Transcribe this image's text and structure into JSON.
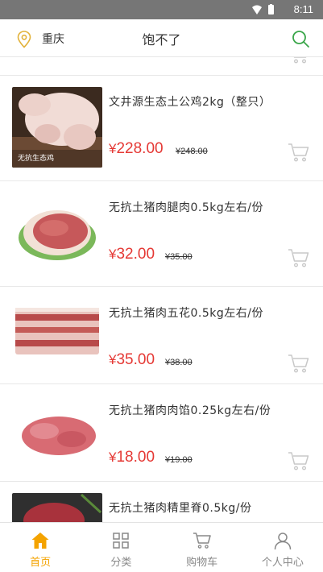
{
  "status": {
    "time": "8:11"
  },
  "header": {
    "city": "重庆",
    "title": "饱不了"
  },
  "products": [
    {
      "name": "",
      "price": "",
      "original": ""
    },
    {
      "name": "文井源生态土公鸡2kg（整只）",
      "price": "228.00",
      "original": "¥248.00",
      "image_overlay": "无抗生态鸡"
    },
    {
      "name": "无抗土猪肉腿肉0.5kg左右/份",
      "price": "32.00",
      "original": "¥35.00"
    },
    {
      "name": "无抗土猪肉五花0.5kg左右/份",
      "price": "35.00",
      "original": "¥38.00"
    },
    {
      "name": "无抗土猪肉肉馅0.25kg左右/份",
      "price": "18.00",
      "original": "¥19.00"
    },
    {
      "name": "无抗土猪肉精里脊0.5kg/份",
      "price": "",
      "original": ""
    }
  ],
  "currency_symbol": "¥",
  "tabbar": [
    {
      "label": "首页",
      "icon": "home-icon",
      "active": true
    },
    {
      "label": "分类",
      "icon": "category-icon",
      "active": false
    },
    {
      "label": "购物车",
      "icon": "cart-icon",
      "active": false
    },
    {
      "label": "个人中心",
      "icon": "user-icon",
      "active": false
    }
  ],
  "colors": {
    "accent": "#f4a300",
    "price": "#e53935",
    "search": "#3aa64a",
    "location": "#e2b23a"
  }
}
